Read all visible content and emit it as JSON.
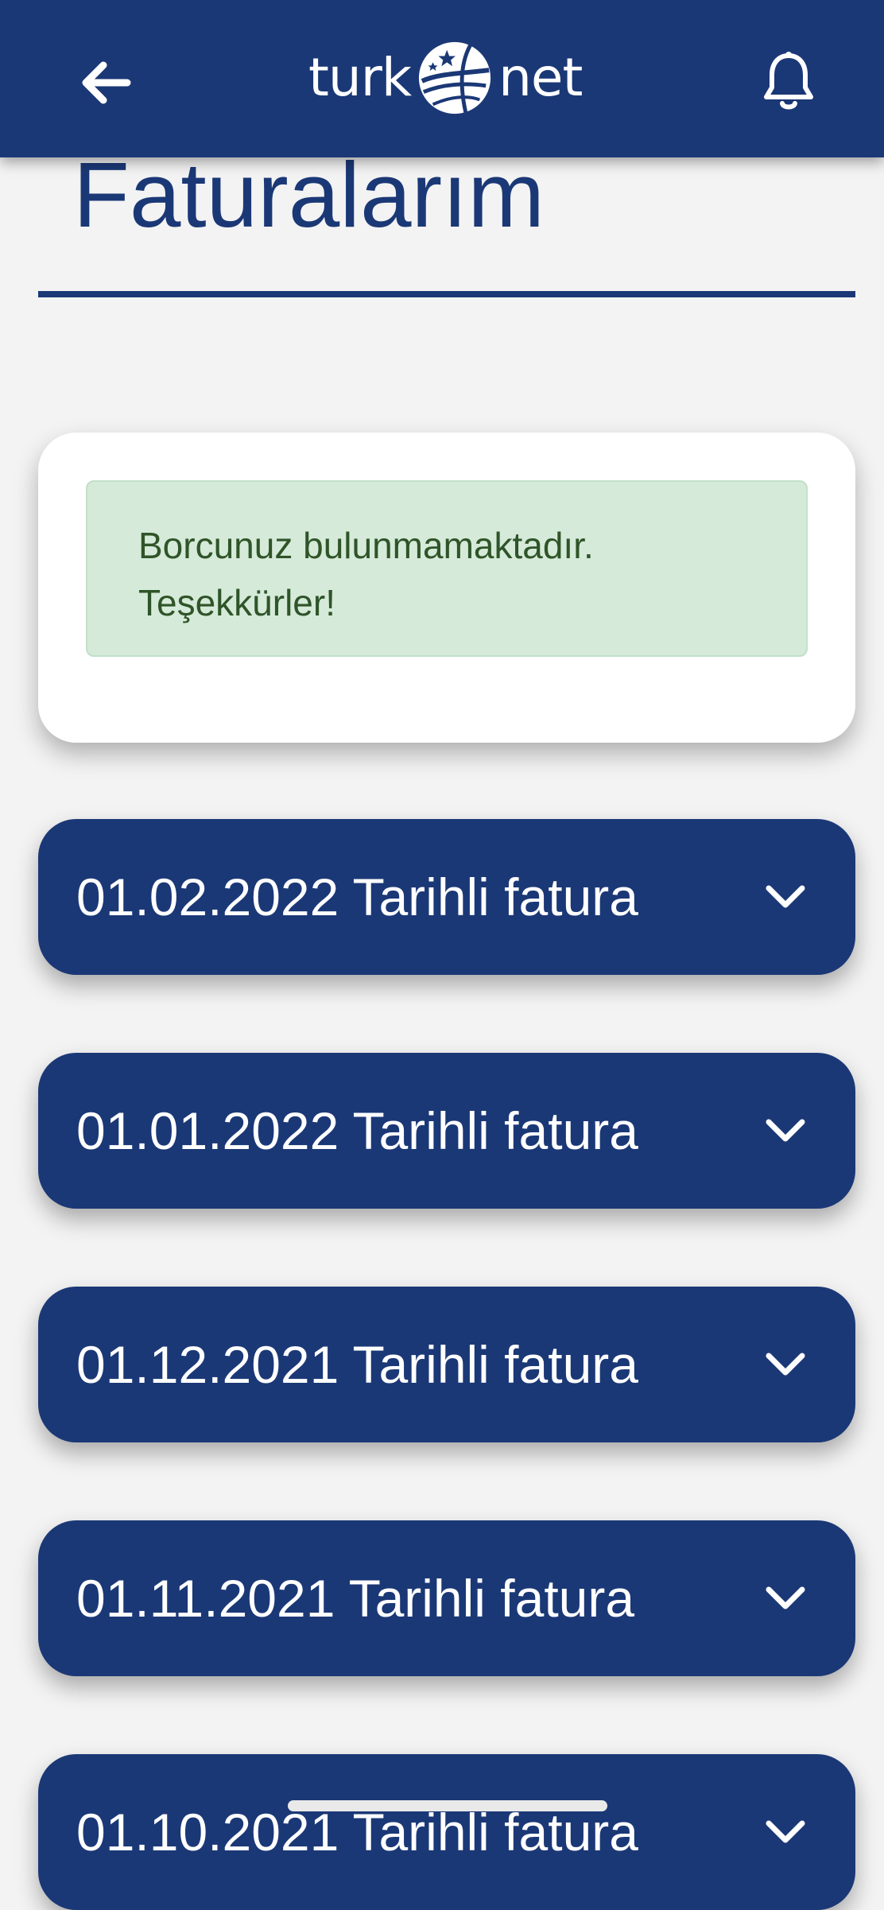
{
  "header": {
    "logo_left": "turk",
    "logo_right": "net",
    "back_icon": "arrow-left-icon",
    "bell_icon": "bell-icon",
    "bar_color": "#1b3876"
  },
  "page": {
    "title": "Faturalarım"
  },
  "notice": {
    "line1": "Borcunuz bulunmamaktadır.",
    "line2": "Teşekkürler!",
    "background_color": "#d5ead9",
    "text_color": "#2f5428"
  },
  "invoices": [
    {
      "label": "01.02.2022 Tarihli fatura"
    },
    {
      "label": "01.01.2022 Tarihli fatura"
    },
    {
      "label": "01.12.2021 Tarihli fatura"
    },
    {
      "label": "01.11.2021 Tarihli fatura"
    },
    {
      "label": "01.10.2021 Tarihli fatura"
    }
  ],
  "theme": {
    "accent": "#1b3876",
    "page_background": "#f3f3f3"
  }
}
